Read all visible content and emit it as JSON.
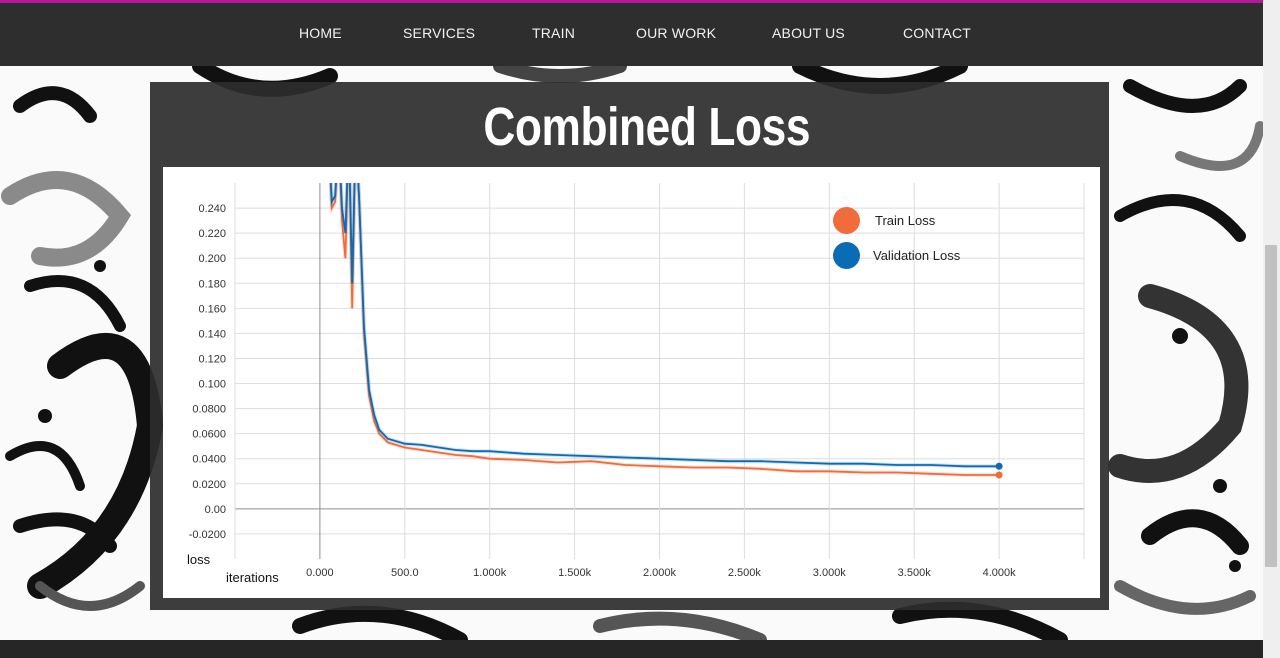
{
  "nav": {
    "items": [
      {
        "label": "HOME"
      },
      {
        "label": "SERVICES"
      },
      {
        "label": "TRAIN"
      },
      {
        "label": "OUR WORK"
      },
      {
        "label": "ABOUT US"
      },
      {
        "label": "CONTACT"
      }
    ]
  },
  "colors": {
    "accent": "#b5179e",
    "navbar": "#2e2e2e",
    "train": "#f26b3a",
    "validation": "#0a6cb5"
  },
  "panel": {
    "title": "Combined Loss"
  },
  "chart_data": {
    "type": "line",
    "title": "Combined Loss",
    "xlabel": "iterations",
    "ylabel": "loss",
    "xlim": [
      -500,
      4500
    ],
    "ylim": [
      -0.04,
      0.26
    ],
    "x_ticks": [
      0,
      500,
      1000,
      1500,
      2000,
      2500,
      3000,
      3500,
      4000
    ],
    "x_tick_labels": [
      "0.000",
      "500.0",
      "1.000k",
      "1.500k",
      "2.000k",
      "2.500k",
      "3.000k",
      "3.500k",
      "4.000k"
    ],
    "y_ticks": [
      -0.02,
      0,
      0.02,
      0.04,
      0.06,
      0.08,
      0.1,
      0.12,
      0.14,
      0.16,
      0.18,
      0.2,
      0.22,
      0.24
    ],
    "y_tick_labels": [
      "-0.0200",
      "0.00",
      "0.0200",
      "0.0400",
      "0.0600",
      "0.0800",
      "0.100",
      "0.120",
      "0.140",
      "0.160",
      "0.180",
      "0.200",
      "0.220",
      "0.240"
    ],
    "grid": true,
    "legend_position": "top-right",
    "series": [
      {
        "name": "Train Loss",
        "color": "#f26b3a",
        "x": [
          50,
          70,
          90,
          110,
          130,
          150,
          170,
          190,
          210,
          230,
          260,
          290,
          320,
          350,
          400,
          500,
          600,
          700,
          800,
          900,
          1000,
          1200,
          1400,
          1600,
          1800,
          2000,
          2200,
          2400,
          2600,
          2800,
          3000,
          3200,
          3400,
          3600,
          3800,
          4000
        ],
        "y": [
          0.3,
          0.24,
          0.245,
          0.3,
          0.23,
          0.2,
          0.3,
          0.16,
          0.3,
          0.25,
          0.14,
          0.09,
          0.07,
          0.06,
          0.053,
          0.049,
          0.047,
          0.045,
          0.043,
          0.042,
          0.04,
          0.039,
          0.037,
          0.038,
          0.035,
          0.034,
          0.033,
          0.033,
          0.032,
          0.03,
          0.03,
          0.029,
          0.029,
          0.028,
          0.027,
          0.027
        ]
      },
      {
        "name": "Validation Loss",
        "color": "#0a6cb5",
        "x": [
          50,
          70,
          90,
          110,
          130,
          150,
          170,
          190,
          210,
          230,
          260,
          290,
          320,
          350,
          400,
          500,
          600,
          700,
          800,
          900,
          1000,
          1200,
          1400,
          1600,
          1800,
          2000,
          2200,
          2400,
          2600,
          2800,
          3000,
          3200,
          3400,
          3600,
          3800,
          4000
        ],
        "y": [
          0.3,
          0.245,
          0.25,
          0.3,
          0.24,
          0.22,
          0.3,
          0.18,
          0.3,
          0.25,
          0.145,
          0.095,
          0.075,
          0.063,
          0.056,
          0.052,
          0.051,
          0.049,
          0.047,
          0.046,
          0.046,
          0.044,
          0.043,
          0.042,
          0.041,
          0.04,
          0.039,
          0.038,
          0.038,
          0.037,
          0.036,
          0.036,
          0.035,
          0.035,
          0.034,
          0.034
        ]
      }
    ]
  }
}
